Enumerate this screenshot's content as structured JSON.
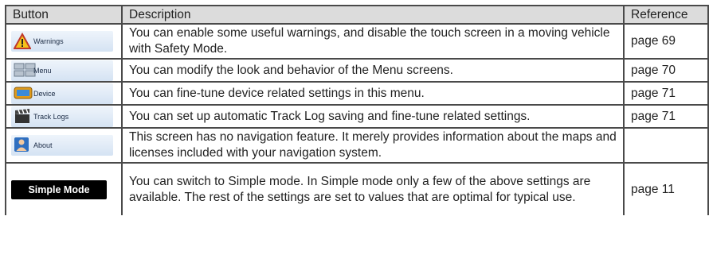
{
  "headers": {
    "button": "Button",
    "description": "Description",
    "reference": "Reference"
  },
  "rows": [
    {
      "button_label": "Warnings",
      "icon": "warning-triangle-icon",
      "description": "You can enable some useful warnings, and disable the touch screen in a moving vehicle with Safety Mode.",
      "reference": "page 69"
    },
    {
      "button_label": "Menu",
      "icon": "menu-grid-icon",
      "description": "You can modify the look and behavior of the Menu screens.",
      "reference": "page 70"
    },
    {
      "button_label": "Device",
      "icon": "device-icon",
      "description": "You can fine-tune device related settings in this menu.",
      "reference": "page 71"
    },
    {
      "button_label": "Track Logs",
      "icon": "clapperboard-icon",
      "description": "You can set up automatic Track Log saving and fine-tune related settings.",
      "reference": "page 71"
    },
    {
      "button_label": "About",
      "icon": "about-person-icon",
      "description": "This screen has no navigation feature. It merely provides information about the maps and licenses included with your navigation system.",
      "reference": ""
    },
    {
      "button_label": "Simple Mode",
      "icon": "",
      "description": "You can switch to Simple mode. In Simple mode only a few of the above settings are available. The rest of the settings are set to values that are optimal for typical use.",
      "reference": "page 11"
    }
  ]
}
